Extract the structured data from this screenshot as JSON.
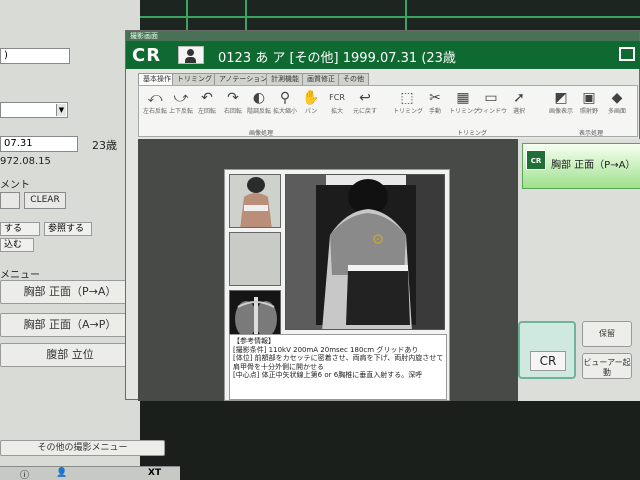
{
  "background": {
    "fields": [
      ")",
      "",
      "07.31",
      "972.08.15",
      "メント"
    ],
    "age": "23歳",
    "clear_label": "CLEAR",
    "tabs": [
      "する",
      "参照する",
      "込む"
    ],
    "menu_header": "メニュー",
    "menu_items": [
      "胸部 正面（P→A）",
      "胸部 正面（A→P）",
      "腹部 立位"
    ],
    "other_menu": "その他の撮影メニュー",
    "footer_xt": "XT"
  },
  "modal": {
    "window_title": "撮影画面",
    "logo": "CR",
    "patient_info": "0123 あ ア [その他] 1999.07.31 (23歳",
    "tabs": [
      "基本操作",
      "トリミング",
      "アノテーション",
      "計測機能",
      "画質修正",
      "その他"
    ],
    "tools": [
      {
        "icon": "⤺",
        "label": "左右反転"
      },
      {
        "icon": "⤻",
        "label": "上下反転"
      },
      {
        "icon": "↶",
        "label": "左回転"
      },
      {
        "icon": "↷",
        "label": "右回転"
      },
      {
        "icon": "◐",
        "label": "階調反転"
      },
      {
        "icon": "⚲",
        "label": "拡大縮小"
      },
      {
        "icon": "✋",
        "label": "パン"
      },
      {
        "icon": "FCR",
        "label": "拡大"
      },
      {
        "icon": "↩",
        "label": "元に戻す"
      },
      {
        "icon": "⬚",
        "label": "トリミング"
      },
      {
        "icon": "✂",
        "label": "手動"
      },
      {
        "icon": "▦",
        "label": "トリミング"
      },
      {
        "icon": "▭",
        "label": "ウィンドウ"
      },
      {
        "icon": "➚",
        "label": "選択"
      },
      {
        "icon": "◩",
        "label": "画像表示"
      },
      {
        "icon": "▣",
        "label": "照射野"
      },
      {
        "icon": "◆",
        "label": "多画面"
      }
    ],
    "group_labels": [
      "画像処理",
      "トリミング",
      "表示処理"
    ],
    "info_lines": [
      "【参考情報】",
      "[撮影条件] 110kV 200mA 20msec 180cm グリッドあり",
      "[体位] 前額部をカセッテに密着させ、両肩を下げ、両肘内旋させて",
      "肩甲骨を十分外側に開かせる",
      "[中心点] 体正中矢状線上第6 or 6胸椎に垂直入射する。深呼"
    ],
    "series_label": "胸部 正面（P→A）",
    "cr_button": "CR",
    "save_label": "保留",
    "viewer_label": "ビューアー起動"
  }
}
